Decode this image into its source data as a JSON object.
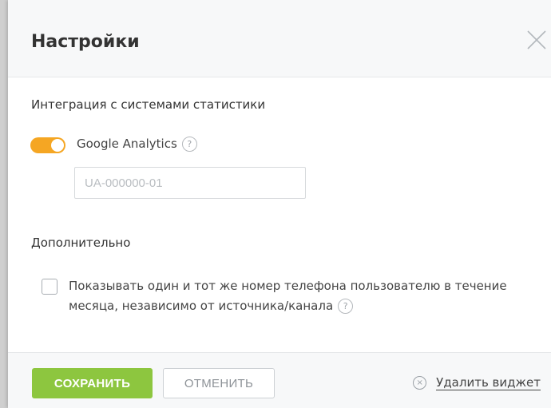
{
  "modal": {
    "title": "Настройки",
    "close_icon": "close-icon"
  },
  "integration": {
    "heading": "Интеграция с системами статистики",
    "google_analytics": {
      "label": "Google Analytics",
      "enabled": true,
      "help_symbol": "?",
      "input_value": "",
      "input_placeholder": "UA-000000-01"
    }
  },
  "additional": {
    "heading": "Дополнительно",
    "same_number": {
      "checked": false,
      "label": "Показывать один и тот же номер телефона пользователю в течение месяца, независимо от источника/канала",
      "help_symbol": "?"
    }
  },
  "footer": {
    "save_label": "СОХРАНИТЬ",
    "cancel_label": "ОТМЕНИТЬ",
    "delete_label": "Удалить виджет",
    "delete_icon_symbol": "×"
  },
  "colors": {
    "toggle_on": "#f5a623",
    "save_button": "#8dc63f",
    "header_bg": "#f7f8f9"
  }
}
